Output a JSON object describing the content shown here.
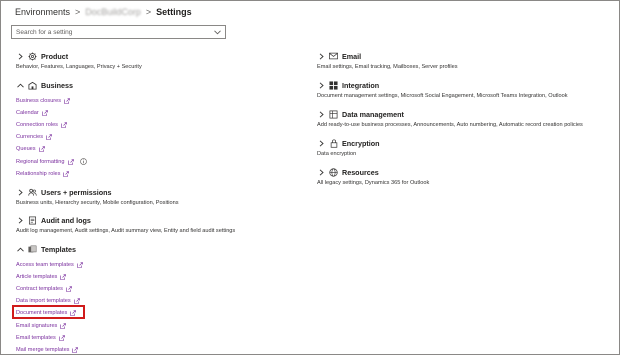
{
  "breadcrumb": {
    "root": "Environments",
    "environment": "DocBuildCorp",
    "current": "Settings"
  },
  "search": {
    "placeholder": "Search for a setting"
  },
  "left_groups": [
    {
      "title": "Product",
      "icon": "gear-icon",
      "expanded": false,
      "description": "Behavior, Features, Languages, Privacy + Security"
    },
    {
      "title": "Business",
      "icon": "building-icon",
      "expanded": true,
      "items": [
        "Business closures",
        "Calendar",
        "Connection roles",
        "Currencies",
        "Queues",
        "Regional formatting",
        "Relationship roles"
      ]
    },
    {
      "title": "Users + permissions",
      "icon": "people-icon",
      "expanded": false,
      "description": "Business units, Hierarchy security, Mobile configuration, Positions"
    },
    {
      "title": "Audit and logs",
      "icon": "audit-icon",
      "expanded": false,
      "description": "Audit log management, Audit settings, Audit summary view, Entity and field audit settings"
    },
    {
      "title": "Templates",
      "icon": "templates-icon",
      "expanded": true,
      "items": [
        "Access team templates",
        "Article templates",
        "Contract templates",
        "Data import templates",
        "Document templates",
        "Email signatures",
        "Email templates",
        "Mail merge templates"
      ]
    }
  ],
  "right_groups": [
    {
      "title": "Email",
      "icon": "mail-icon",
      "description": "Email settings, Email tracking, Mailboxes, Server profiles"
    },
    {
      "title": "Integration",
      "icon": "windows-icon",
      "description": "Document management settings, Microsoft Social Engagement, Microsoft Teams Integration, Outlook"
    },
    {
      "title": "Data management",
      "icon": "data-management-icon",
      "description": "Add ready-to-use business processes, Announcements, Auto numbering, Automatic record creation policies"
    },
    {
      "title": "Encryption",
      "icon": "lock-icon",
      "description": "Data encryption"
    },
    {
      "title": "Resources",
      "icon": "globe-icon",
      "description": "All legacy settings, Dynamics 365 for Outlook"
    }
  ],
  "highlighted_item": "Document templates",
  "colors": {
    "link": "#7a2f9e",
    "highlight": "#d01b1b",
    "text": "#323130"
  }
}
